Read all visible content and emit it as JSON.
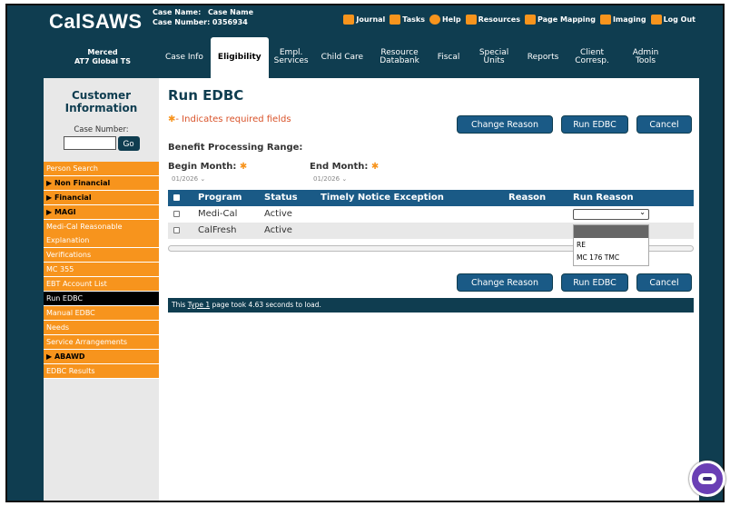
{
  "header": {
    "logo": "CalSAWS",
    "case_name_label": "Case Name:",
    "case_name_value": "Case Name",
    "case_number_label": "Case Number:",
    "case_number_value": "0356934",
    "links": [
      {
        "label": "Journal",
        "icon": "journal-icon",
        "color": "#f7941d"
      },
      {
        "label": "Tasks",
        "icon": "tasks-icon",
        "color": "#f7941d"
      },
      {
        "label": "Help",
        "icon": "help-icon",
        "color": "#f7941d"
      },
      {
        "label": "Resources",
        "icon": "resources-icon",
        "color": "#f7941d"
      },
      {
        "label": "Page Mapping",
        "icon": "page-mapping-icon",
        "color": "#f7941d"
      },
      {
        "label": "Imaging",
        "icon": "imaging-icon",
        "color": "#f7941d"
      },
      {
        "label": "Log Out",
        "icon": "logout-icon",
        "color": "#f7941d"
      }
    ]
  },
  "nav": {
    "office_line1": "Merced",
    "office_line2": "AT7 Global TS",
    "tabs": [
      {
        "label": "Case Info",
        "active": false
      },
      {
        "label": "Eligibility",
        "active": true
      },
      {
        "label": "Empl. Services",
        "active": false
      },
      {
        "label": "Child Care",
        "active": false
      },
      {
        "label": "Resource Databank",
        "active": false
      },
      {
        "label": "Fiscal",
        "active": false
      },
      {
        "label": "Special Units",
        "active": false
      },
      {
        "label": "Reports",
        "active": false
      },
      {
        "label": "Client Corresp.",
        "active": false
      },
      {
        "label": "Admin Tools",
        "active": false
      }
    ]
  },
  "sidebar": {
    "title": "Customer Information",
    "case_number_label": "Case Number:",
    "go_label": "Go",
    "items": [
      {
        "label": "Person Search",
        "type": "link"
      },
      {
        "label": "Non Financial",
        "type": "group"
      },
      {
        "label": "Financial",
        "type": "group"
      },
      {
        "label": "MAGI",
        "type": "group"
      },
      {
        "label": "Medi-Cal Reasonable Explanation",
        "type": "tall"
      },
      {
        "label": "Verifications",
        "type": "link"
      },
      {
        "label": "MC 355",
        "type": "link"
      },
      {
        "label": "EBT Account List",
        "type": "link"
      },
      {
        "label": "Run EDBC",
        "type": "active"
      },
      {
        "label": "Manual EDBC",
        "type": "link"
      },
      {
        "label": "Needs",
        "type": "link"
      },
      {
        "label": "Service Arrangements",
        "type": "link"
      },
      {
        "label": "ABAWD",
        "type": "group"
      },
      {
        "label": "EDBC Results",
        "type": "link"
      }
    ]
  },
  "main": {
    "title": "Run EDBC",
    "required_note": "- Indicates required fields",
    "buttons": {
      "change_reason": "Change Reason",
      "run_edbc": "Run EDBC",
      "cancel": "Cancel"
    },
    "benefit_range_label": "Benefit Processing Range:",
    "begin_month_label": "Begin Month:",
    "end_month_label": "End Month:",
    "begin_month_value": "01/2026",
    "end_month_value": "01/2026",
    "table": {
      "headers": [
        "Program",
        "Status",
        "Timely Notice Exception",
        "Reason",
        "Run Reason"
      ],
      "rows": [
        {
          "program": "Medi-Cal",
          "status": "Active"
        },
        {
          "program": "CalFresh",
          "status": "Active"
        }
      ]
    },
    "dropdown_options": [
      "RE",
      "MC 176 TMC"
    ],
    "load_text_prefix": "This ",
    "load_text_link": "Type 1",
    "load_text_suffix": " page took 4.63 seconds to load."
  },
  "colors": {
    "navy": "#0f3d50",
    "orange": "#f7941d",
    "button_blue": "#1a5a86"
  }
}
